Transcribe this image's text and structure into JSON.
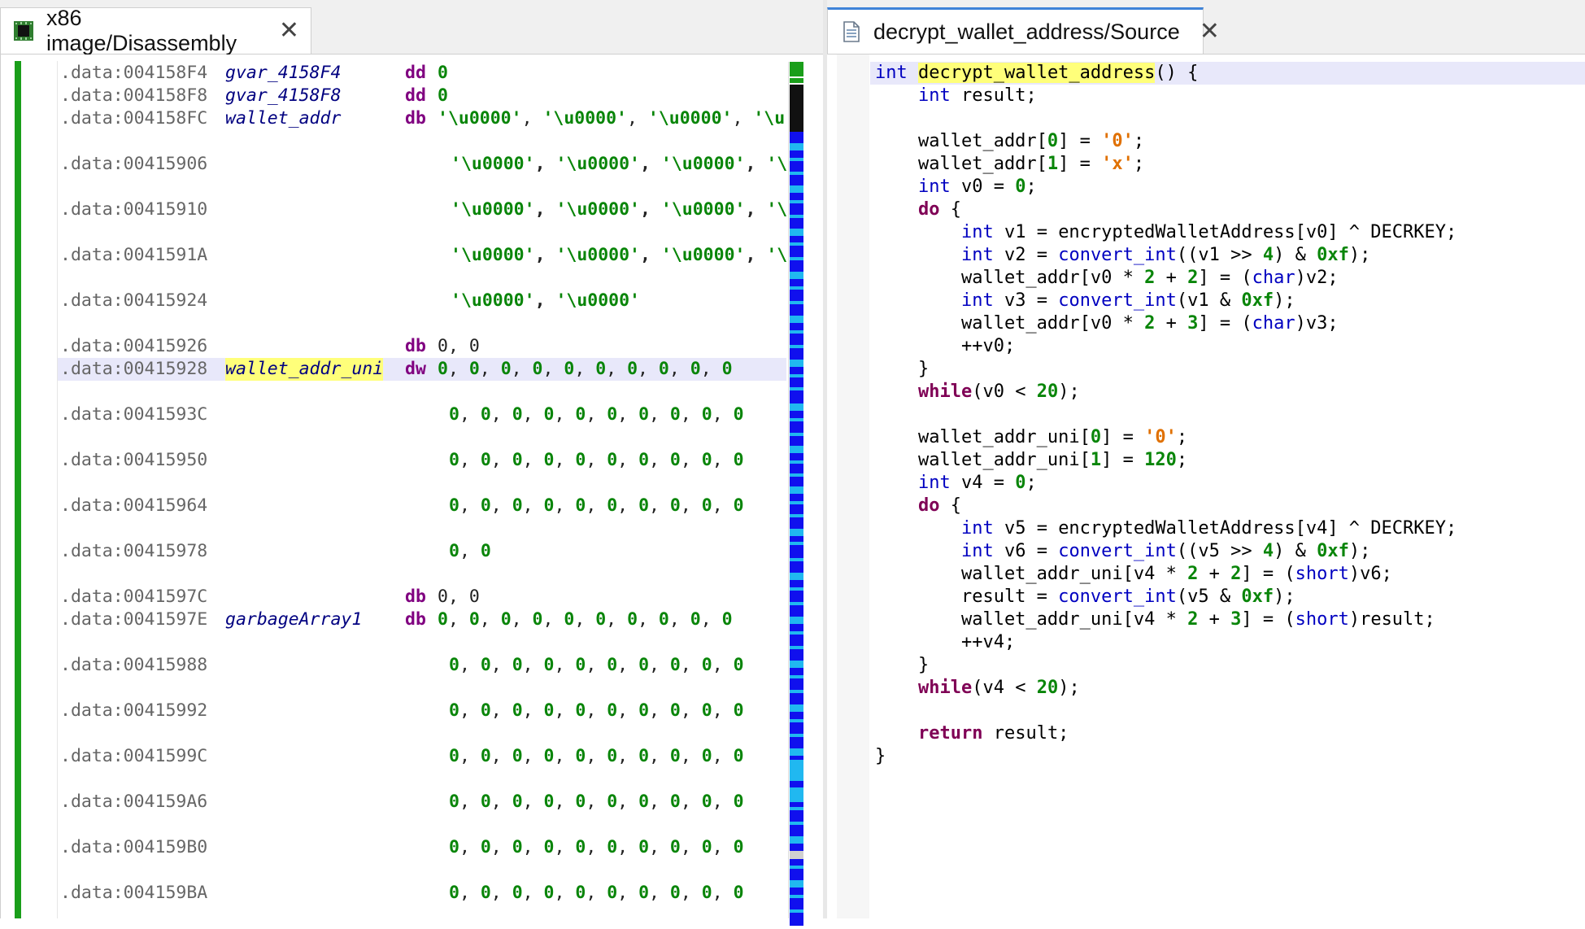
{
  "left_tab": {
    "title": "x86 image/Disassembly",
    "icon": "chip-icon",
    "close": "✕"
  },
  "right_tab": {
    "title": "decrypt_wallet_address/Source",
    "icon": "document-icon",
    "close": "✕"
  },
  "colors": {
    "gutter_green": "#1a9e1a",
    "tab_accent": "#3f83d8",
    "highlight": "#ffff7a",
    "current_line": "#e8e8fa"
  },
  "disassembly": [
    {
      "addr": ".data:004158F4",
      "name": "gvar_4158F4",
      "dir": "dd",
      "vals": [
        "0"
      ],
      "kind": "num"
    },
    {
      "addr": ".data:004158F8",
      "name": "gvar_4158F8",
      "dir": "dd",
      "vals": [
        "0"
      ],
      "kind": "num"
    },
    {
      "addr": ".data:004158FC",
      "name": "wallet_addr",
      "dir": "db",
      "vals": [
        "'\\u0000'",
        "'\\u0000'",
        "'\\u0000'",
        "'\\u"
      ],
      "kind": "str"
    },
    {
      "blank": true
    },
    {
      "addr": ".data:00415906",
      "cont": [
        "'\\u0000'",
        "'\\u0000'",
        "'\\u0000'",
        "'\\"
      ],
      "kind": "str"
    },
    {
      "blank": true
    },
    {
      "addr": ".data:00415910",
      "cont": [
        "'\\u0000'",
        "'\\u0000'",
        "'\\u0000'",
        "'\\"
      ],
      "kind": "str"
    },
    {
      "blank": true
    },
    {
      "addr": ".data:0041591A",
      "cont": [
        "'\\u0000'",
        "'\\u0000'",
        "'\\u0000'",
        "'\\"
      ],
      "kind": "str"
    },
    {
      "blank": true
    },
    {
      "addr": ".data:00415924",
      "cont": [
        "'\\u0000'",
        "'\\u0000'"
      ],
      "kind": "str",
      "noTrail": true
    },
    {
      "blank": true
    },
    {
      "addr": ".data:00415926",
      "dir": "db",
      "vals": [
        "0",
        "0"
      ],
      "kind": "plain"
    },
    {
      "addr": ".data:00415928",
      "name": "wallet_addr_uni",
      "dir": "dw",
      "vals": [
        "0",
        "0",
        "0",
        "0",
        "0",
        "0",
        "0",
        "0",
        "0",
        "0"
      ],
      "kind": "num",
      "highlight": true
    },
    {
      "blank": true
    },
    {
      "addr": ".data:0041593C",
      "cont": [
        "0",
        "0",
        "0",
        "0",
        "0",
        "0",
        "0",
        "0",
        "0",
        "0"
      ],
      "kind": "num"
    },
    {
      "blank": true
    },
    {
      "addr": ".data:00415950",
      "cont": [
        "0",
        "0",
        "0",
        "0",
        "0",
        "0",
        "0",
        "0",
        "0",
        "0"
      ],
      "kind": "num"
    },
    {
      "blank": true
    },
    {
      "addr": ".data:00415964",
      "cont": [
        "0",
        "0",
        "0",
        "0",
        "0",
        "0",
        "0",
        "0",
        "0",
        "0"
      ],
      "kind": "num"
    },
    {
      "blank": true
    },
    {
      "addr": ".data:00415978",
      "cont": [
        "0",
        "0"
      ],
      "kind": "num"
    },
    {
      "blank": true
    },
    {
      "addr": ".data:0041597C",
      "dir": "db",
      "vals": [
        "0",
        "0"
      ],
      "kind": "plain"
    },
    {
      "addr": ".data:0041597E",
      "name": "garbageArray1",
      "dir": "db",
      "vals": [
        "0",
        "0",
        "0",
        "0",
        "0",
        "0",
        "0",
        "0",
        "0",
        "0"
      ],
      "kind": "num"
    },
    {
      "blank": true
    },
    {
      "addr": ".data:00415988",
      "cont": [
        "0",
        "0",
        "0",
        "0",
        "0",
        "0",
        "0",
        "0",
        "0",
        "0"
      ],
      "kind": "num"
    },
    {
      "blank": true
    },
    {
      "addr": ".data:00415992",
      "cont": [
        "0",
        "0",
        "0",
        "0",
        "0",
        "0",
        "0",
        "0",
        "0",
        "0"
      ],
      "kind": "num"
    },
    {
      "blank": true
    },
    {
      "addr": ".data:0041599C",
      "cont": [
        "0",
        "0",
        "0",
        "0",
        "0",
        "0",
        "0",
        "0",
        "0",
        "0"
      ],
      "kind": "num"
    },
    {
      "blank": true
    },
    {
      "addr": ".data:004159A6",
      "cont": [
        "0",
        "0",
        "0",
        "0",
        "0",
        "0",
        "0",
        "0",
        "0",
        "0"
      ],
      "kind": "num"
    },
    {
      "blank": true
    },
    {
      "addr": ".data:004159B0",
      "cont": [
        "0",
        "0",
        "0",
        "0",
        "0",
        "0",
        "0",
        "0",
        "0",
        "0"
      ],
      "kind": "num"
    },
    {
      "blank": true
    },
    {
      "addr": ".data:004159BA",
      "cont": [
        "0",
        "0",
        "0",
        "0",
        "0",
        "0",
        "0",
        "0",
        "0",
        "0"
      ],
      "kind": "num"
    }
  ],
  "source": [
    [
      [
        "kw",
        "int"
      ],
      [
        "t",
        " "
      ],
      [
        "fnhl",
        "decrypt_wallet_address"
      ],
      [
        "t",
        "() {"
      ]
    ],
    [
      [
        "t",
        "    "
      ],
      [
        "kw",
        "int"
      ],
      [
        "t",
        " result;"
      ]
    ],
    [],
    [
      [
        "t",
        "    wallet_addr["
      ],
      [
        "n",
        "0"
      ],
      [
        "t",
        "] = "
      ],
      [
        "chr",
        "'0'"
      ],
      [
        "t",
        ";"
      ]
    ],
    [
      [
        "t",
        "    wallet_addr["
      ],
      [
        "n",
        "1"
      ],
      [
        "t",
        "] = "
      ],
      [
        "chr",
        "'x'"
      ],
      [
        "t",
        ";"
      ]
    ],
    [
      [
        "t",
        "    "
      ],
      [
        "kw",
        "int"
      ],
      [
        "t",
        " v0 = "
      ],
      [
        "n",
        "0"
      ],
      [
        "t",
        ";"
      ]
    ],
    [
      [
        "t",
        "    "
      ],
      [
        "kwb",
        "do"
      ],
      [
        "t",
        " {"
      ]
    ],
    [
      [
        "t",
        "        "
      ],
      [
        "kw",
        "int"
      ],
      [
        "t",
        " v1 = encryptedWalletAddress[v0] ^ DECRKEY;"
      ]
    ],
    [
      [
        "t",
        "        "
      ],
      [
        "kw",
        "int"
      ],
      [
        "t",
        " v2 = "
      ],
      [
        "fn",
        "convert_int"
      ],
      [
        "t",
        "((v1 >> "
      ],
      [
        "n",
        "4"
      ],
      [
        "t",
        ") & "
      ],
      [
        "n",
        "0xf"
      ],
      [
        "t",
        ");"
      ]
    ],
    [
      [
        "t",
        "        wallet_addr[v0 * "
      ],
      [
        "n",
        "2"
      ],
      [
        "t",
        " + "
      ],
      [
        "n",
        "2"
      ],
      [
        "t",
        "] = ("
      ],
      [
        "cast",
        "char"
      ],
      [
        "t",
        ")v2;"
      ]
    ],
    [
      [
        "t",
        "        "
      ],
      [
        "kw",
        "int"
      ],
      [
        "t",
        " v3 = "
      ],
      [
        "fn",
        "convert_int"
      ],
      [
        "t",
        "(v1 & "
      ],
      [
        "n",
        "0xf"
      ],
      [
        "t",
        ");"
      ]
    ],
    [
      [
        "t",
        "        wallet_addr[v0 * "
      ],
      [
        "n",
        "2"
      ],
      [
        "t",
        " + "
      ],
      [
        "n",
        "3"
      ],
      [
        "t",
        "] = ("
      ],
      [
        "cast",
        "char"
      ],
      [
        "t",
        ")v3;"
      ]
    ],
    [
      [
        "t",
        "        ++v0;"
      ]
    ],
    [
      [
        "t",
        "    }"
      ]
    ],
    [
      [
        "t",
        "    "
      ],
      [
        "kwb",
        "while"
      ],
      [
        "t",
        "(v0 < "
      ],
      [
        "n",
        "20"
      ],
      [
        "t",
        ");"
      ]
    ],
    [],
    [
      [
        "t",
        "    wallet_addr_uni["
      ],
      [
        "n",
        "0"
      ],
      [
        "t",
        "] = "
      ],
      [
        "chr",
        "'0'"
      ],
      [
        "t",
        ";"
      ]
    ],
    [
      [
        "t",
        "    wallet_addr_uni["
      ],
      [
        "n",
        "1"
      ],
      [
        "t",
        "] = "
      ],
      [
        "n",
        "120"
      ],
      [
        "t",
        ";"
      ]
    ],
    [
      [
        "t",
        "    "
      ],
      [
        "kw",
        "int"
      ],
      [
        "t",
        " v4 = "
      ],
      [
        "n",
        "0"
      ],
      [
        "t",
        ";"
      ]
    ],
    [
      [
        "t",
        "    "
      ],
      [
        "kwb",
        "do"
      ],
      [
        "t",
        " {"
      ]
    ],
    [
      [
        "t",
        "        "
      ],
      [
        "kw",
        "int"
      ],
      [
        "t",
        " v5 = encryptedWalletAddress[v4] ^ DECRKEY;"
      ]
    ],
    [
      [
        "t",
        "        "
      ],
      [
        "kw",
        "int"
      ],
      [
        "t",
        " v6 = "
      ],
      [
        "fn",
        "convert_int"
      ],
      [
        "t",
        "((v5 >> "
      ],
      [
        "n",
        "4"
      ],
      [
        "t",
        ") & "
      ],
      [
        "n",
        "0xf"
      ],
      [
        "t",
        ");"
      ]
    ],
    [
      [
        "t",
        "        wallet_addr_uni[v4 * "
      ],
      [
        "n",
        "2"
      ],
      [
        "t",
        " + "
      ],
      [
        "n",
        "2"
      ],
      [
        "t",
        "] = ("
      ],
      [
        "cast",
        "short"
      ],
      [
        "t",
        ")v6;"
      ]
    ],
    [
      [
        "t",
        "        result = "
      ],
      [
        "fn",
        "convert_int"
      ],
      [
        "t",
        "(v5 & "
      ],
      [
        "n",
        "0xf"
      ],
      [
        "t",
        ");"
      ]
    ],
    [
      [
        "t",
        "        wallet_addr_uni[v4 * "
      ],
      [
        "n",
        "2"
      ],
      [
        "t",
        " + "
      ],
      [
        "n",
        "3"
      ],
      [
        "t",
        "] = ("
      ],
      [
        "cast",
        "short"
      ],
      [
        "t",
        ")result;"
      ]
    ],
    [
      [
        "t",
        "        ++v4;"
      ]
    ],
    [
      [
        "t",
        "    }"
      ]
    ],
    [
      [
        "t",
        "    "
      ],
      [
        "kwb",
        "while"
      ],
      [
        "t",
        "(v4 < "
      ],
      [
        "n",
        "20"
      ],
      [
        "t",
        ");"
      ]
    ],
    [],
    [
      [
        "t",
        "    "
      ],
      [
        "kwb",
        "return"
      ],
      [
        "t",
        " result;"
      ]
    ],
    [
      [
        "t",
        "}"
      ]
    ]
  ]
}
